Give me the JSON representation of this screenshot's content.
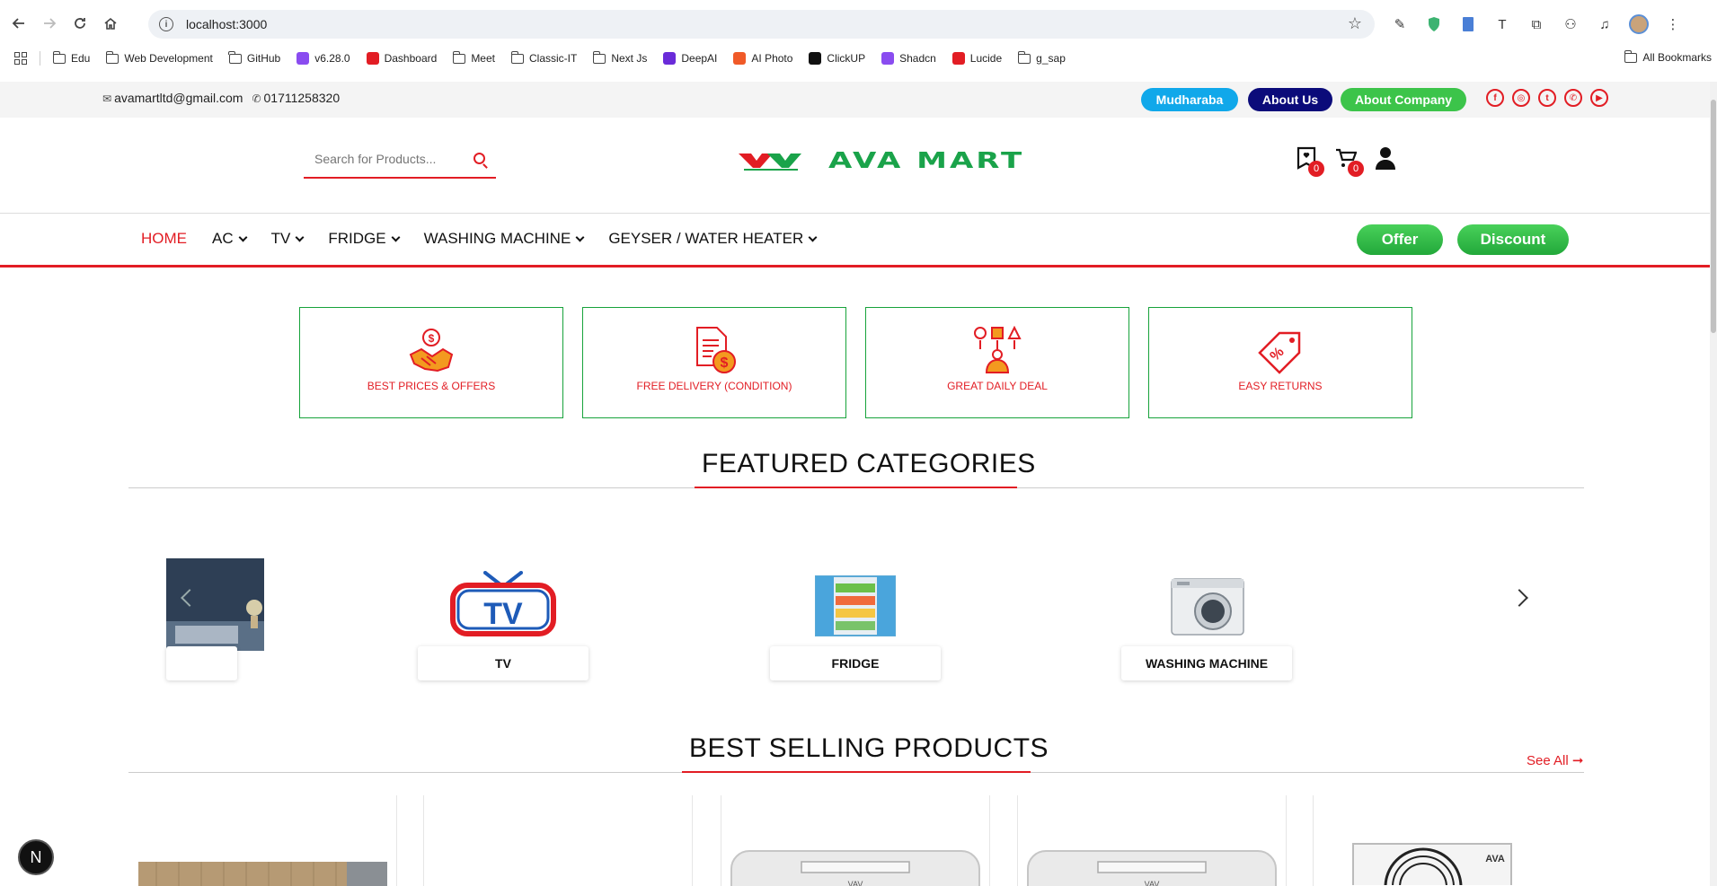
{
  "browser": {
    "url": "localhost:3000",
    "bookmarks": [
      {
        "label": "Edu",
        "icon": "folder-icon"
      },
      {
        "label": "Web Development",
        "icon": "folder-icon"
      },
      {
        "label": "GitHub",
        "icon": "folder-icon"
      },
      {
        "label": "v6.28.0",
        "icon": "site-icon"
      },
      {
        "label": "Dashboard",
        "icon": "site-icon"
      },
      {
        "label": "Meet",
        "icon": "folder-icon"
      },
      {
        "label": "Classic-IT",
        "icon": "folder-icon"
      },
      {
        "label": "Next Js",
        "icon": "folder-icon"
      },
      {
        "label": "DeepAI",
        "icon": "site-icon"
      },
      {
        "label": "AI Photo",
        "icon": "site-icon"
      },
      {
        "label": "ClickUP",
        "icon": "site-icon"
      },
      {
        "label": "Shadcn",
        "icon": "site-icon"
      },
      {
        "label": "Lucide",
        "icon": "site-icon"
      },
      {
        "label": "g_sap",
        "icon": "folder-icon"
      }
    ],
    "all_bookmarks": "All Bookmarks"
  },
  "topbar": {
    "email": "avamartltd@gmail.com",
    "phone": "01711258320",
    "buttons": {
      "mudharaba": "Mudharaba",
      "about_us": "About Us",
      "about_company": "About Company"
    },
    "socials": [
      "facebook-icon",
      "instagram-icon",
      "twitter-icon",
      "whatsapp-icon",
      "youtube-icon"
    ]
  },
  "header": {
    "search_placeholder": "Search for Products...",
    "logo_text": "AVA MART",
    "wishlist_count": "0",
    "cart_count": "0"
  },
  "nav": {
    "items": [
      {
        "label": "HOME",
        "dropdown": false
      },
      {
        "label": "AC",
        "dropdown": true
      },
      {
        "label": "TV",
        "dropdown": true
      },
      {
        "label": "FRIDGE",
        "dropdown": true
      },
      {
        "label": "WASHING MACHINE",
        "dropdown": true
      },
      {
        "label": "GEYSER / WATER HEATER",
        "dropdown": true
      }
    ],
    "offer": "Offer",
    "discount": "Discount"
  },
  "features": [
    {
      "label": "BEST PRICES & OFFERS",
      "icon": "handshake-dollar-icon"
    },
    {
      "label": "FREE DELIVERY (CONDITION)",
      "icon": "invoice-dollar-icon"
    },
    {
      "label": "GREAT DAILY DEAL",
      "icon": "choices-person-icon"
    },
    {
      "label": "EASY RETURNS",
      "icon": "discount-tag-icon"
    }
  ],
  "featured_title": "FEATURED CATEGORIES",
  "categories": [
    {
      "label": "",
      "image": "ac-bedroom-image"
    },
    {
      "label": "TV",
      "image": "tv-logo-image"
    },
    {
      "label": "FRIDGE",
      "image": "fridge-image"
    },
    {
      "label": "WASHING MACHINE",
      "image": "washing-machine-image"
    }
  ],
  "best_selling_title": "BEST SELLING PRODUCTS",
  "see_all": "See All",
  "colors": {
    "brand_red": "#e21d24",
    "brand_green": "#1aa34a",
    "mudharaba_blue": "#10a8ea",
    "about_navy": "#0b0b7a"
  }
}
